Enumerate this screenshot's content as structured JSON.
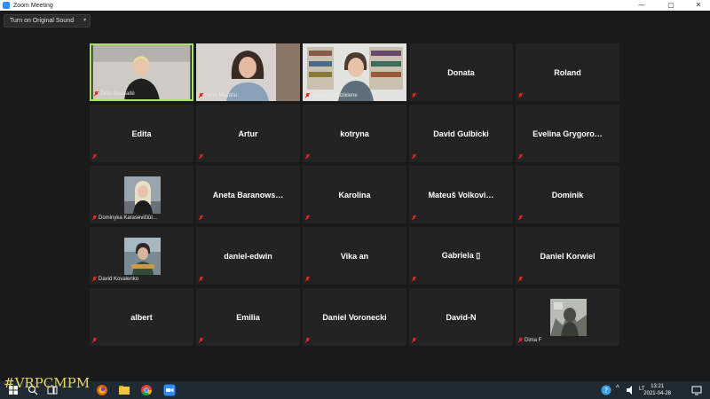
{
  "window": {
    "title": "Zoom Meeting"
  },
  "toolbar": {
    "original_sound_label": "Turn on Original Sound"
  },
  "participants": [
    {
      "name": "Žinlu Gausaitė",
      "mode": "video"
    },
    {
      "name": "Irena Mazaliu",
      "mode": "video"
    },
    {
      "name": "Žaneta Sardzikiene",
      "mode": "video"
    },
    {
      "name": "Donata",
      "mode": "name"
    },
    {
      "name": "Roland",
      "mode": "name"
    },
    {
      "name": "Edita",
      "mode": "name"
    },
    {
      "name": "Artur",
      "mode": "name"
    },
    {
      "name": "kotryna",
      "mode": "name"
    },
    {
      "name": "David Gulbicki",
      "mode": "name"
    },
    {
      "name": "Evelina Grygoro…",
      "mode": "name"
    },
    {
      "name": "Dominyka Karasevičiūt…",
      "mode": "avatar"
    },
    {
      "name": "Aneta Baranows…",
      "mode": "name"
    },
    {
      "name": "Karolina",
      "mode": "name"
    },
    {
      "name": "Mateuš Volkovi…",
      "mode": "name"
    },
    {
      "name": "Dominik",
      "mode": "name"
    },
    {
      "name": "David Kovalenko",
      "mode": "avatar"
    },
    {
      "name": "daniel-edwin",
      "mode": "name"
    },
    {
      "name": "Vika an",
      "mode": "name"
    },
    {
      "name": "Gabriela ▯",
      "mode": "name"
    },
    {
      "name": "Daniel Korwiel",
      "mode": "name"
    },
    {
      "name": "albert",
      "mode": "name"
    },
    {
      "name": "Emilia",
      "mode": "name"
    },
    {
      "name": "Daniel Voronecki",
      "mode": "name"
    },
    {
      "name": "David-N",
      "mode": "name"
    },
    {
      "name": "Dima F",
      "mode": "avatar"
    }
  ],
  "taskbar": {
    "language": "LT",
    "time": "13:21",
    "date": "2021-04-28",
    "icons": [
      "windows-start-icon",
      "search-icon",
      "task-view-icon",
      "firefox-icon",
      "file-explorer-icon",
      "chrome-icon",
      "zoom-icon"
    ]
  },
  "watermark": {
    "text": "#VRPCMPM"
  },
  "colors": {
    "active_speaker": "#a8e05f",
    "muted": "#e02828",
    "tile_bg": "#232323",
    "zoom_blue": "#2d8cff"
  }
}
